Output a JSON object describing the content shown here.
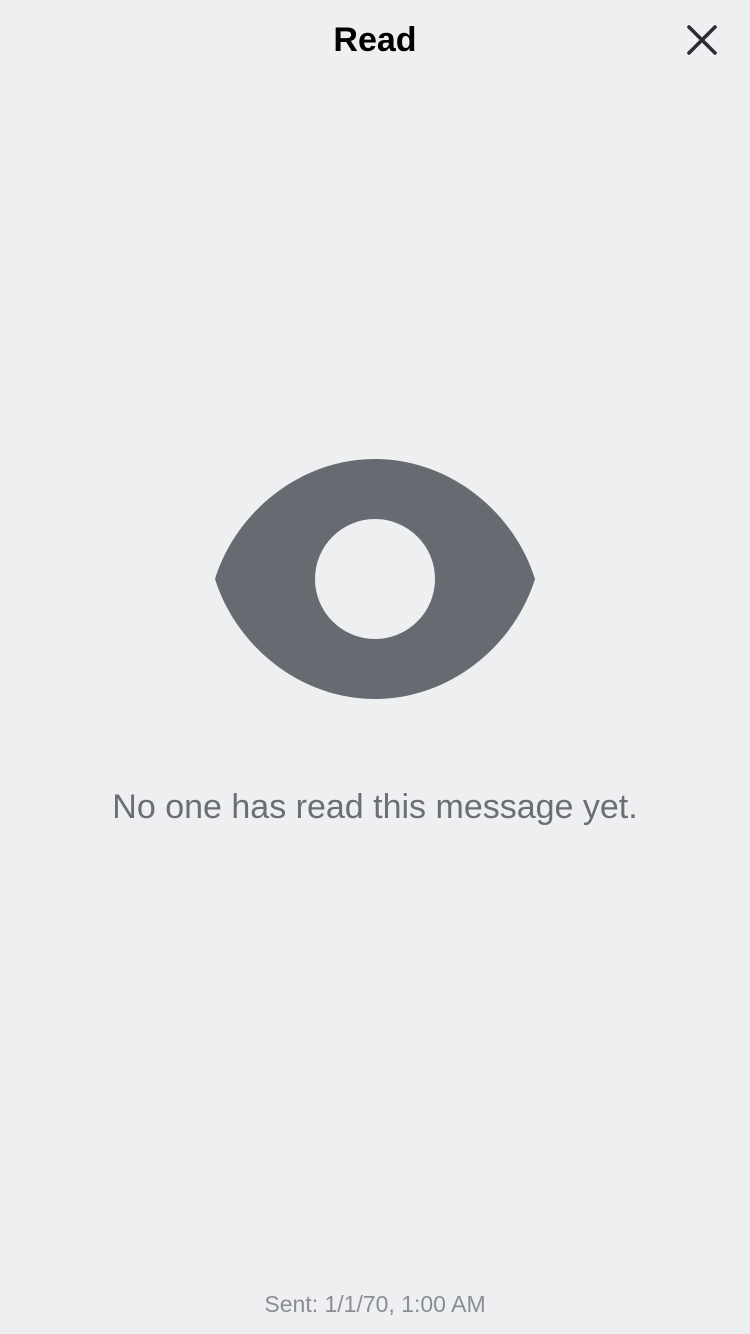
{
  "header": {
    "title": "Read",
    "close_icon": "close-icon"
  },
  "empty_state": {
    "icon": "eye-icon",
    "message": "No one has read this message yet."
  },
  "footer": {
    "sent_text": "Sent: 1/1/70, 1:00 AM"
  },
  "colors": {
    "background": "#EEEFF1",
    "icon": "#676A71",
    "message_text": "#6B6E74",
    "footer_text": "#8A8D93",
    "title_text": "#000000"
  }
}
